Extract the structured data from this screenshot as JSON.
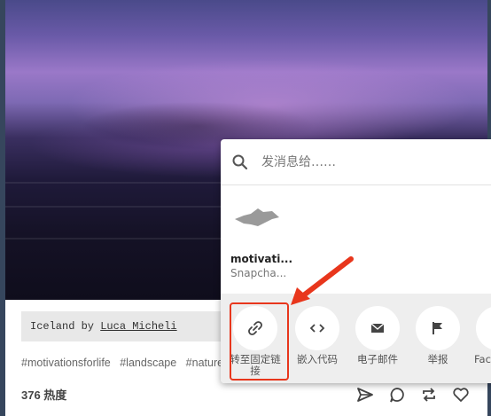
{
  "post": {
    "caption_prefix": "Iceland by ",
    "caption_link": "Luca Micheli",
    "tags": [
      "#motivationsforlife",
      "#landscape",
      "#nature"
    ],
    "notes": "376 热度"
  },
  "share": {
    "search_placeholder": "发消息给……",
    "recipient": {
      "name": "motivati...",
      "sub": "Snapcha..."
    },
    "buttons": [
      {
        "label": "转至固定链接",
        "icon": "link-icon"
      },
      {
        "label": "嵌入代码",
        "icon": "code-icon"
      },
      {
        "label": "电子邮件",
        "icon": "mail-icon"
      },
      {
        "label": "举报",
        "icon": "flag-icon"
      },
      {
        "label": "Facebook",
        "icon": "facebook-icon"
      }
    ]
  },
  "annotation_color": "#e8361c"
}
